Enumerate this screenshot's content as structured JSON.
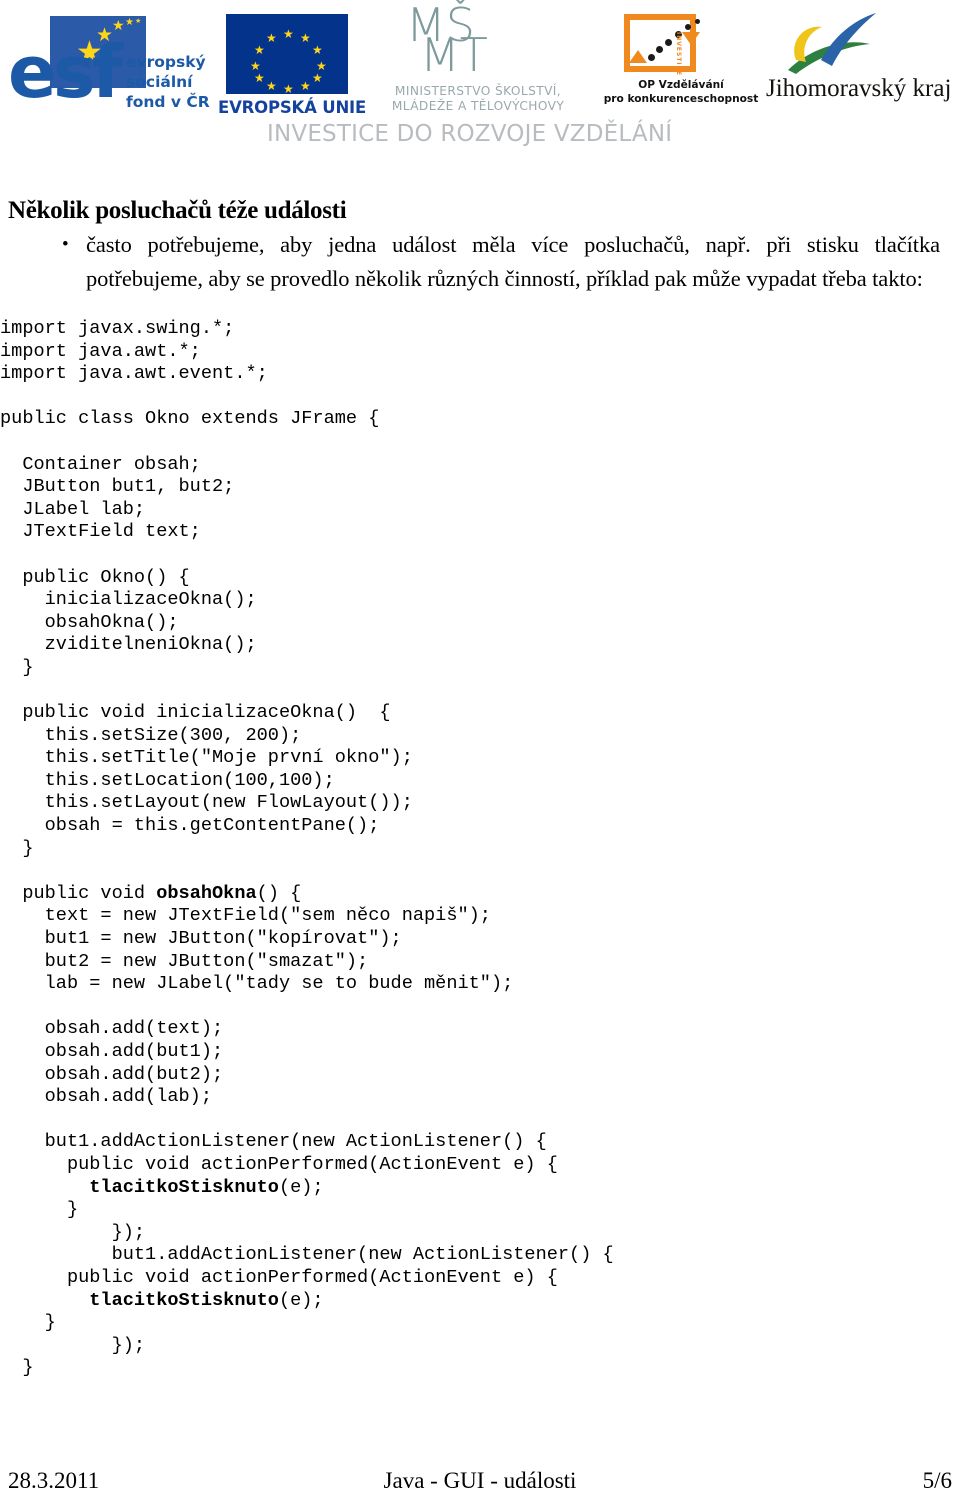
{
  "header": {
    "logos": {
      "esf": {
        "letters": "esf",
        "words_line1": "evropský",
        "words_line2": "sociální",
        "words_line3": "fond v ČR"
      },
      "eu": {
        "caption": "EVROPSKÁ UNIE"
      },
      "msmt": {
        "mark_line1": "MŠ",
        "mark_line2": "MT",
        "caption_line1": "MINISTERSTVO ŠKOLSTVÍ,",
        "caption_line2": "MLÁDEŽE A TĚLOVÝCHOVY"
      },
      "op": {
        "caption_line1": "OP Vzdělávání",
        "caption_line2": "pro konkurenceschopnost",
        "vertical_text": "INVESTICE"
      },
      "jmk": {
        "caption": "Jihomoravský kraj"
      }
    },
    "slogan": "INVESTICE DO ROZVOJE VZDĚLÁNÍ",
    "colors": {
      "esf_blue": "#1c5aa8",
      "eu_blue": "#04338b",
      "eu_star_yellow": "#ffd617",
      "msmt_gray": "#7d9a9c",
      "msmt_caption_gray": "#9aa8ad",
      "op_orange": "#f08a1e",
      "jmk_yellow": "#f0c419",
      "jmk_blue": "#2b63a8",
      "jmk_green": "#2e8040",
      "slogan_gray": "#b7bcc0"
    }
  },
  "title": "Několik posluchačů téže události",
  "bullet": {
    "marker": "•",
    "text": "často potřebujeme, aby jedna událost měla více posluchačů, např. při stisku tlačítka potřebujeme, aby se provedlo několik různých činností, příklad pak může vypadat třeba takto:"
  },
  "code": {
    "lines": [
      {
        "text": "import javax.swing.*;"
      },
      {
        "text": "import java.awt.*;"
      },
      {
        "text": "import java.awt.event.*;"
      },
      {
        "text": ""
      },
      {
        "text": "public class Okno extends JFrame {"
      },
      {
        "text": ""
      },
      {
        "text": "  Container obsah;"
      },
      {
        "text": "  JButton but1, but2;"
      },
      {
        "text": "  JLabel lab;"
      },
      {
        "text": "  JTextField text;"
      },
      {
        "text": ""
      },
      {
        "text": "  public Okno() {"
      },
      {
        "text": "    inicializaceOkna();"
      },
      {
        "text": "    obsahOkna();"
      },
      {
        "text": "    zviditelneniOkna();"
      },
      {
        "text": "  }"
      },
      {
        "text": ""
      },
      {
        "text": "  public void inicializaceOkna()  {"
      },
      {
        "text": "    this.setSize(300, 200);"
      },
      {
        "text": "    this.setTitle(\"Moje první okno\");"
      },
      {
        "text": "    this.setLocation(100,100);"
      },
      {
        "text": "    this.setLayout(new FlowLayout());"
      },
      {
        "text": "    obsah = this.getContentPane();"
      },
      {
        "text": "  }"
      },
      {
        "text": ""
      },
      {
        "pre": "  public void ",
        "bold": "obsahOkna",
        "post": "() {"
      },
      {
        "text": "    text = new JTextField(\"sem něco napiš\");"
      },
      {
        "text": "    but1 = new JButton(\"kopírovat\");"
      },
      {
        "text": "    but2 = new JButton(\"smazat\");"
      },
      {
        "text": "    lab = new JLabel(\"tady se to bude měnit\");"
      },
      {
        "text": ""
      },
      {
        "text": "    obsah.add(text);"
      },
      {
        "text": "    obsah.add(but1);"
      },
      {
        "text": "    obsah.add(but2);"
      },
      {
        "text": "    obsah.add(lab);"
      },
      {
        "text": ""
      },
      {
        "text": "    but1.addActionListener(new ActionListener() {"
      },
      {
        "text": "      public void actionPerformed(ActionEvent e) {"
      },
      {
        "pre": "        ",
        "bold": "tlacitkoStisknuto",
        "post": "(e);"
      },
      {
        "text": "      }"
      },
      {
        "text": "          });"
      },
      {
        "text": "          but1.addActionListener(new ActionListener() {"
      },
      {
        "text": "      public void actionPerformed(ActionEvent e) {"
      },
      {
        "pre": "        ",
        "bold": "tlacitkoStisknuto",
        "post": "(e);"
      },
      {
        "text": "    }"
      },
      {
        "text": "          });"
      },
      {
        "text": "  }"
      }
    ]
  },
  "footer": {
    "date": "28.3.2011",
    "center": "Java - GUI - události",
    "page": "5/6"
  }
}
